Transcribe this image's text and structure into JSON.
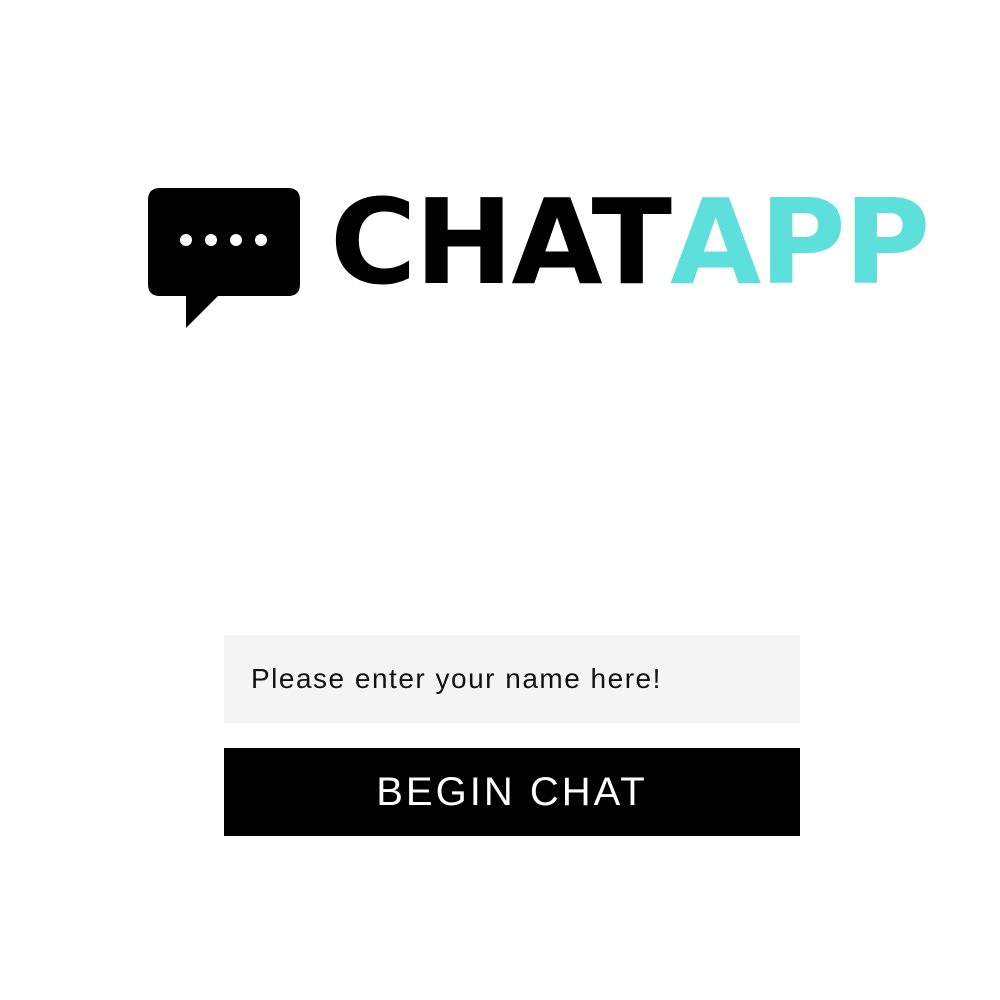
{
  "logo": {
    "word_dark": "CHAT",
    "word_accent": "APP",
    "icon": "chat-bubble-icon",
    "accent_color": "#5ddfdc",
    "dark_color": "#000000"
  },
  "form": {
    "name_input": {
      "value": "",
      "placeholder": "Please enter your name here!"
    },
    "submit_label": "BEGIN CHAT"
  },
  "colors": {
    "background": "#ffffff",
    "input_background": "#f4f4f4",
    "button_background": "#000000",
    "button_text": "#ffffff"
  }
}
